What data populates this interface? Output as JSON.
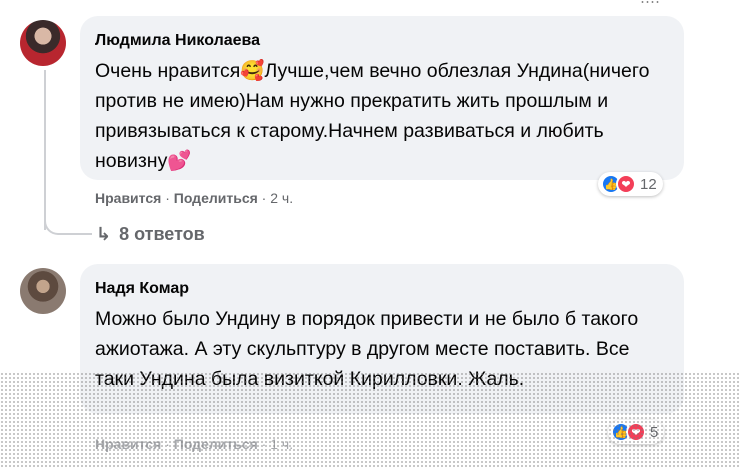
{
  "comments": [
    {
      "author": "Людмила Николаева",
      "text": "Очень нравится🥰Лучше,чем вечно облезлая Ундина(ничего против не имею)Нам нужно прекратить жить прошлым и привязываться к старому.Начнем развиваться и любить новизну💕",
      "actions": {
        "like": "Нравится",
        "sep": "·",
        "share": "Поделиться",
        "time": "2 ч."
      },
      "reaction_count": "12",
      "reaction_icons": [
        "like-icon",
        "love-icon"
      ]
    },
    {
      "author": "Надя Комар",
      "text": "Можно было Ундину в порядок привести и не было б такого ажиотажа. А эту скульптуру в другом месте поставить. Все таки Ундина была визиткой Кирилловки. Жаль.",
      "actions": {
        "like": "Нравится",
        "sep": "·",
        "share": "Поделиться",
        "time": "1 ч."
      },
      "reaction_count": "5",
      "reaction_icons": [
        "like-icon",
        "love-icon"
      ]
    }
  ],
  "replies_link": {
    "icon": "reply-arrow-icon",
    "label": "8 ответов"
  },
  "colors": {
    "bubble": "#f0f2f5",
    "secondary_text": "#65676b",
    "like": "#1877f2",
    "love": "#f33e58"
  }
}
